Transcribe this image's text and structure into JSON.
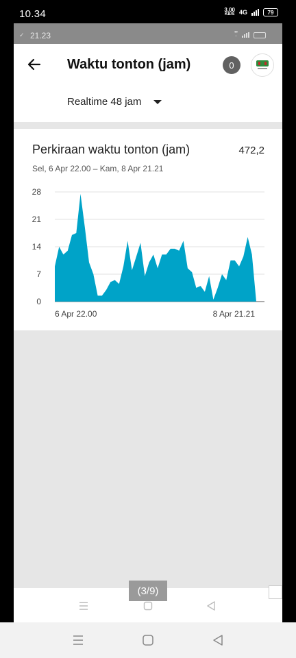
{
  "status_bar": {
    "time": "10.34",
    "speed": "3.00",
    "speed_unit": "KB/S",
    "network": "4G",
    "battery": "79"
  },
  "inner_status_bar": {
    "time": "21.23"
  },
  "header": {
    "title": "Waktu tonton (jam)",
    "notification_count": "0"
  },
  "range": {
    "selected": "Realtime 48 jam"
  },
  "card": {
    "title": "Perkiraan waktu tonton (jam)",
    "total": "472,2",
    "date_range": "Sel, 6 Apr 22.00 – Kam, 8 Apr 21.21"
  },
  "chart_data": {
    "type": "area",
    "color": "#00a3c8",
    "y_ticks": [
      "0",
      "7",
      "14",
      "21",
      "28"
    ],
    "ylim": [
      0,
      28
    ],
    "x_start_label": "6 Apr 22.00",
    "x_end_label": "8 Apr 21.21",
    "values": [
      9,
      14,
      12,
      13,
      17,
      17.5,
      27.5,
      19,
      10,
      7,
      1.5,
      1.5,
      3,
      5,
      5.5,
      4.5,
      9,
      15.5,
      8,
      11.5,
      15,
      6.5,
      10,
      12,
      8.5,
      12,
      12,
      13.5,
      13.5,
      13,
      15.5,
      8.5,
      7.5,
      3.5,
      4,
      2.5,
      6.5,
      0.5,
      3.5,
      7,
      5.5,
      10.5,
      10.5,
      9,
      11.5,
      16.5,
      12,
      0
    ]
  },
  "page_counter": "(3/9)",
  "colors": {
    "accent": "#00a3c8",
    "background": "#e6e6e6"
  }
}
